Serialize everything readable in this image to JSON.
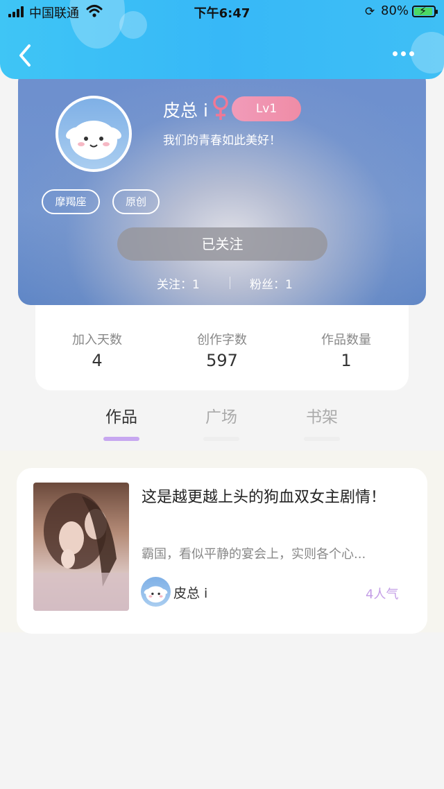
{
  "status_bar": {
    "carrier": "中国联通",
    "time": "下午6:47",
    "battery_percent": "80%",
    "battery_level": 0.8
  },
  "nav": {
    "back_icon": "chevron-left-icon",
    "more_icon": "more-dots-icon"
  },
  "profile": {
    "username": "皮总 i",
    "level": "Lv1",
    "bio": "我们的青春如此美好！",
    "tags": [
      "摩羯座",
      "原创"
    ],
    "follow_button": "已关注",
    "following": "关注：1",
    "fans": "粉丝：1"
  },
  "stats": [
    {
      "label": "加入天数",
      "value": "4"
    },
    {
      "label": "创作字数",
      "value": "597"
    },
    {
      "label": "作品数量",
      "value": "1"
    }
  ],
  "tabs": [
    {
      "label": "作品",
      "active": true
    },
    {
      "label": "广场",
      "active": false
    },
    {
      "label": "书架",
      "active": false
    }
  ],
  "works": [
    {
      "title": "这是越更越上头的狗血双女主剧情！",
      "description": "霸国，看似平静的宴会上，实则各个心...",
      "author": "皮总 i",
      "popularity": "4人气"
    }
  ],
  "colors": {
    "topbar": "#3fc5f5",
    "level_badge": "#ef8ca6",
    "tab_underline_active": "#c7a7f0",
    "popularity": "#c39de6"
  }
}
